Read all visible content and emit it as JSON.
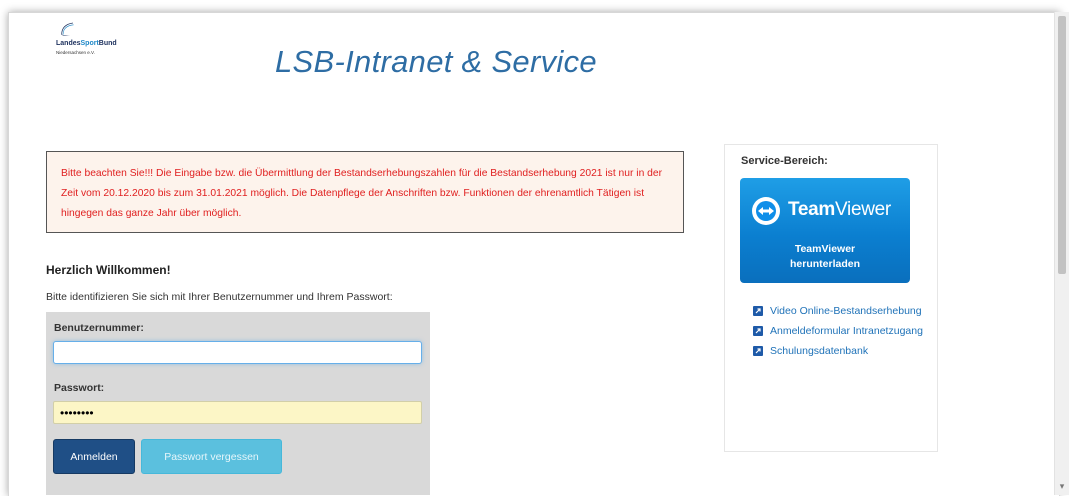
{
  "header": {
    "logo": {
      "name_part1": "Landes",
      "name_part2": "Sport",
      "name_part3": "Bund",
      "subline": "Niedersachsen e.V."
    },
    "title": "LSB-Intranet & Service"
  },
  "notice": {
    "text": "Bitte beachten Sie!!! Die Eingabe bzw. die Übermittlung der Bestandserhebungszahlen für die Bestandserhebung 2021 ist nur in der Zeit vom 20.12.2020 bis zum 31.01.2021 möglich. Die Datenpflege der Anschriften bzw. Funktionen der ehrenamtlich Tätigen ist hingegen das ganze Jahr über möglich.",
    "color": "#e02020"
  },
  "login": {
    "welcome": "Herzlich Willkommen!",
    "instruction": "Bitte identifizieren Sie sich mit Ihrer Benutzernummer und Ihrem Passwort:",
    "username_label": "Benutzernummer:",
    "username_value": "",
    "password_label": "Passwort:",
    "password_value": "••••••••",
    "login_button": "Anmelden",
    "forgot_button": "Passwort vergessen"
  },
  "service": {
    "title": "Service-Bereich:",
    "teamviewer": {
      "brand_bold": "Team",
      "brand_light": "Viewer",
      "caption_line1": "TeamViewer",
      "caption_line2": "herunterladen",
      "icon": "teamviewer-icon"
    },
    "links": [
      {
        "label": "Video Online-Bestandserhebung",
        "icon": "external-link-icon"
      },
      {
        "label": "Anmeldeformular Intranetzugang",
        "icon": "external-link-icon"
      },
      {
        "label": "Schulungsdatenbank",
        "icon": "external-link-icon"
      }
    ]
  }
}
